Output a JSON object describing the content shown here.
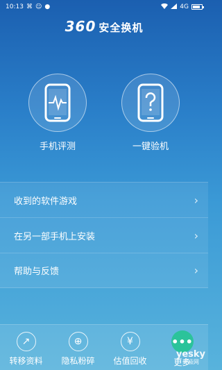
{
  "status_bar": {
    "time": "10:13",
    "left_icons": [
      "usb-icon",
      "message-icon",
      "app-notification-icon"
    ],
    "network": "4G",
    "battery_level": 0.8
  },
  "header": {
    "logo_number": "360",
    "logo_text": "安全换机"
  },
  "features": [
    {
      "label": "手机评测",
      "icon": "phone-heartbeat-icon"
    },
    {
      "label": "一键验机",
      "icon": "phone-question-icon"
    }
  ],
  "menu": [
    {
      "label": "收到的软件游戏"
    },
    {
      "label": "在另一部手机上安装"
    },
    {
      "label": "帮助与反馈"
    }
  ],
  "bottom_nav": [
    {
      "label": "转移资料",
      "icon": "transfer-icon",
      "glyph": "↗"
    },
    {
      "label": "隐私粉碎",
      "icon": "shield-icon",
      "glyph": "⊕"
    },
    {
      "label": "估值回收",
      "icon": "yuan-icon",
      "glyph": "¥"
    },
    {
      "label": "更多",
      "icon": "more-icon",
      "glyph": "•••"
    }
  ],
  "watermark": {
    "brand": "yesky",
    "sub": "天极网"
  },
  "colors": {
    "accent_green": "#2bc39a",
    "bg_top": "#1b5fb0",
    "bg_bottom": "#58b3dc"
  }
}
